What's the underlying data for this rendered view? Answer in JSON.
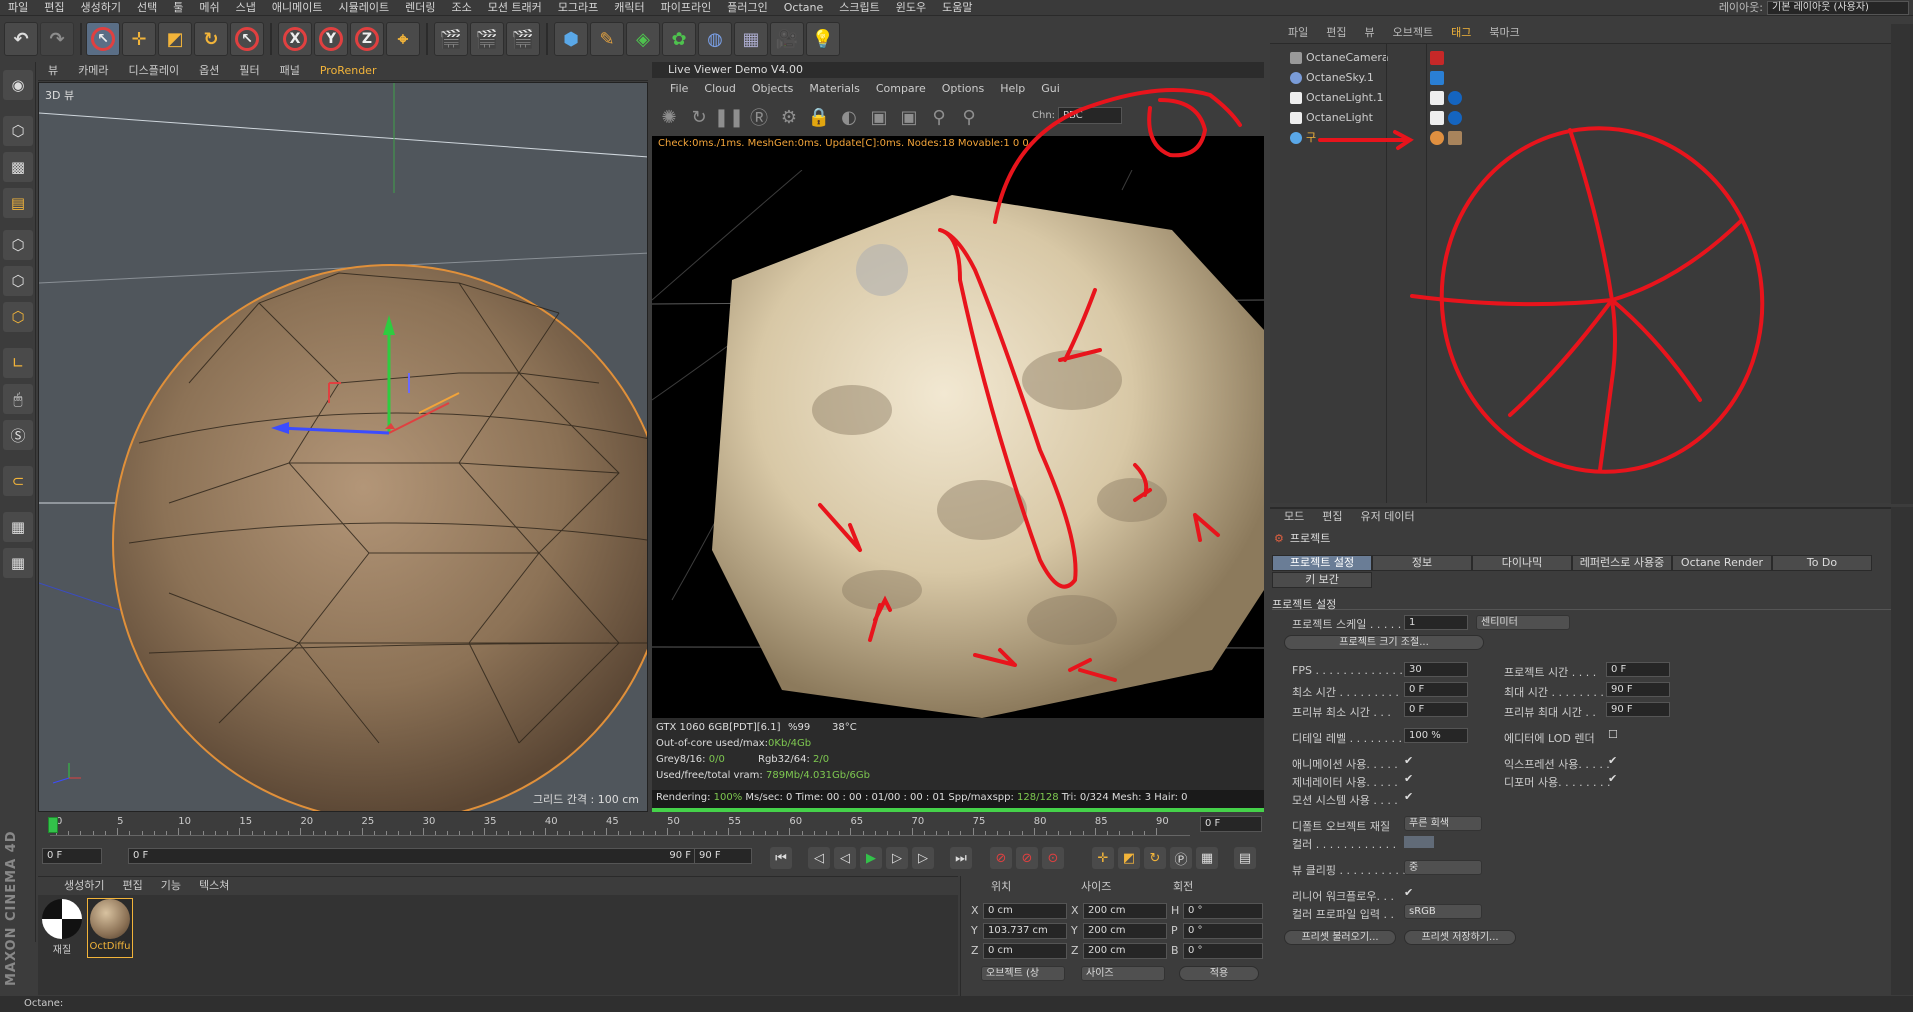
{
  "menubar": {
    "items": [
      "파일",
      "편집",
      "생성하기",
      "선택",
      "툴",
      "메쉬",
      "스냅",
      "애니메이트",
      "시뮬레이트",
      "렌더링",
      "조소",
      "모션 트래커",
      "모그라프",
      "캐릭터",
      "파이프라인",
      "플러그인",
      "Octane",
      "스크립트",
      "윈도우",
      "도움말"
    ],
    "layout_label": "레이아웃:",
    "layout_value": "기본 레이아웃 (사용자)"
  },
  "viewport": {
    "menu": [
      "뷰",
      "카메라",
      "디스플레이",
      "옵션",
      "필터",
      "패널",
      "ProRender"
    ],
    "label": "3D 뷰",
    "grid": "그리드 간격 : 100 cm"
  },
  "live_viewer": {
    "title": "Live Viewer Demo V4.00",
    "menu": [
      "File",
      "Cloud",
      "Objects",
      "Materials",
      "Compare",
      "Options",
      "Help",
      "Gui"
    ],
    "chn_label": "Chn:",
    "chn_value": "PBC",
    "status": "Check:0ms./1ms. MeshGen:0ms. Update[C]:0ms. Nodes:18 Movable:1  0 0",
    "stats": {
      "gpu": "GTX 1060 6GB[PDT][6.1]",
      "pct": "%99",
      "temp": "38°C",
      "ooc_label": "Out-of-core used/max:",
      "ooc_value": "0Kb/4Gb",
      "grey_label": "Grey8/16:",
      "grey_value": "0/0",
      "rgb_label": "Rgb32/64:",
      "rgb_value": "2/0",
      "vram_label": "Used/free/total vram:",
      "vram_value": "789Mb/4.031Gb/6Gb"
    },
    "bottom_a": "Rendering:",
    "bottom_pct": "100%",
    "bottom_b": "Ms/sec: 0   Time: 00 : 00 : 01/00 : 00 : 01     Spp/maxspp:",
    "bottom_spp": "128/128",
    "bottom_c": "Tri: 0/324   Mesh: 3  Hair: 0"
  },
  "timeline": {
    "ticks": [
      "0",
      "5",
      "10",
      "15",
      "20",
      "25",
      "30",
      "35",
      "40",
      "45",
      "50",
      "55",
      "60",
      "65",
      "70",
      "75",
      "80",
      "85",
      "90"
    ],
    "current_frame": "0 F",
    "start": "0 F",
    "start2": "0 F",
    "end_inner": "90 F",
    "end": "90 F"
  },
  "material_manager": {
    "menu": [
      "생성하기",
      "편집",
      "기능",
      "텍스쳐"
    ],
    "materials": [
      "재질",
      "OctDiffu"
    ]
  },
  "coordinates": {
    "headers": [
      "위치",
      "사이즈",
      "회전"
    ],
    "rows": [
      {
        "axis": "X",
        "pos": "0 cm",
        "sax": "X",
        "size": "200 cm",
        "rax": "H",
        "rot": "0 °"
      },
      {
        "axis": "Y",
        "pos": "103.737 cm",
        "sax": "Y",
        "size": "200 cm",
        "rax": "P",
        "rot": "0 °"
      },
      {
        "axis": "Z",
        "pos": "0 cm",
        "sax": "Z",
        "size": "200 cm",
        "rax": "B",
        "rot": "0 °"
      }
    ],
    "mode_select": "오브젝트 (상",
    "size_select": "사이즈",
    "apply": "적용"
  },
  "object_manager": {
    "menu": [
      "파일",
      "편집",
      "뷰",
      "오브젝트",
      "태그",
      "북마크"
    ],
    "objects": [
      "OctaneCamera",
      "OctaneSky.1",
      "OctaneLight.1",
      "OctaneLight",
      "구"
    ]
  },
  "attribute_manager": {
    "menu": [
      "모드",
      "편집",
      "유저 데이터"
    ],
    "title": "프로젝트",
    "tabs": [
      "프로젝트 설정",
      "정보",
      "다이나믹",
      "레퍼런스로 사용중",
      "Octane Render",
      "To Do",
      "키 보간"
    ],
    "section": "프로젝트 설정",
    "scale_label": "프로젝트 스케일 . . . . .",
    "scale_value": "1",
    "scale_unit": "센티미터",
    "scale_btn": "프로젝트 크기 조절...",
    "fps_label": "FPS . . . . . . . . . . . . . . .",
    "fps_value": "30",
    "ptime_label": "프로젝트 시간 . . . .",
    "ptime_value": "0 F",
    "min_label": "최소 시간 . . . . . . . . .",
    "min_value": "0 F",
    "max_label": "최대 시간 . . . . . . . .",
    "max_value": "90 F",
    "pmin_label": "프리뷰 최소 시간 . . .",
    "pmin_value": "0 F",
    "pmax_label": "프리뷰 최대 시간 . .",
    "pmax_value": "90 F",
    "lod_label": "디테일 레벨 . . . . . . . .",
    "lod_value": "100 %",
    "elod_label": "에디터에 LOD 렌더",
    "anim_label": "애니메이션 사용. . . . .",
    "expr_label": "익스프레션 사용. . . . .",
    "gen_label": "제네레이터 사용. . . . .",
    "def_label": "디포머 사용. . . . . . . .",
    "motion_label": "모션 시스템 사용 . . . .",
    "defobj_label": "디폴트 오브젝트 재질",
    "defobj_value": "푸른 회색",
    "color_label": "컬러 . . . . . . . . . . . .",
    "clip_label": "뷰 클리핑 . . . . . . . . . .",
    "clip_value": "중",
    "linear_label": "리니어 워크플로우. . .",
    "profile_label": "컬러 프로파일 입력 . .",
    "profile_value": "sRGB",
    "load_btn": "프리셋 불러오기...",
    "save_btn": "프리셋 저장하기..."
  },
  "statusbar": "Octane:",
  "colors": {
    "accent": "#f2b43a",
    "annotation": "#e8141c",
    "progress": "#45d24a"
  }
}
